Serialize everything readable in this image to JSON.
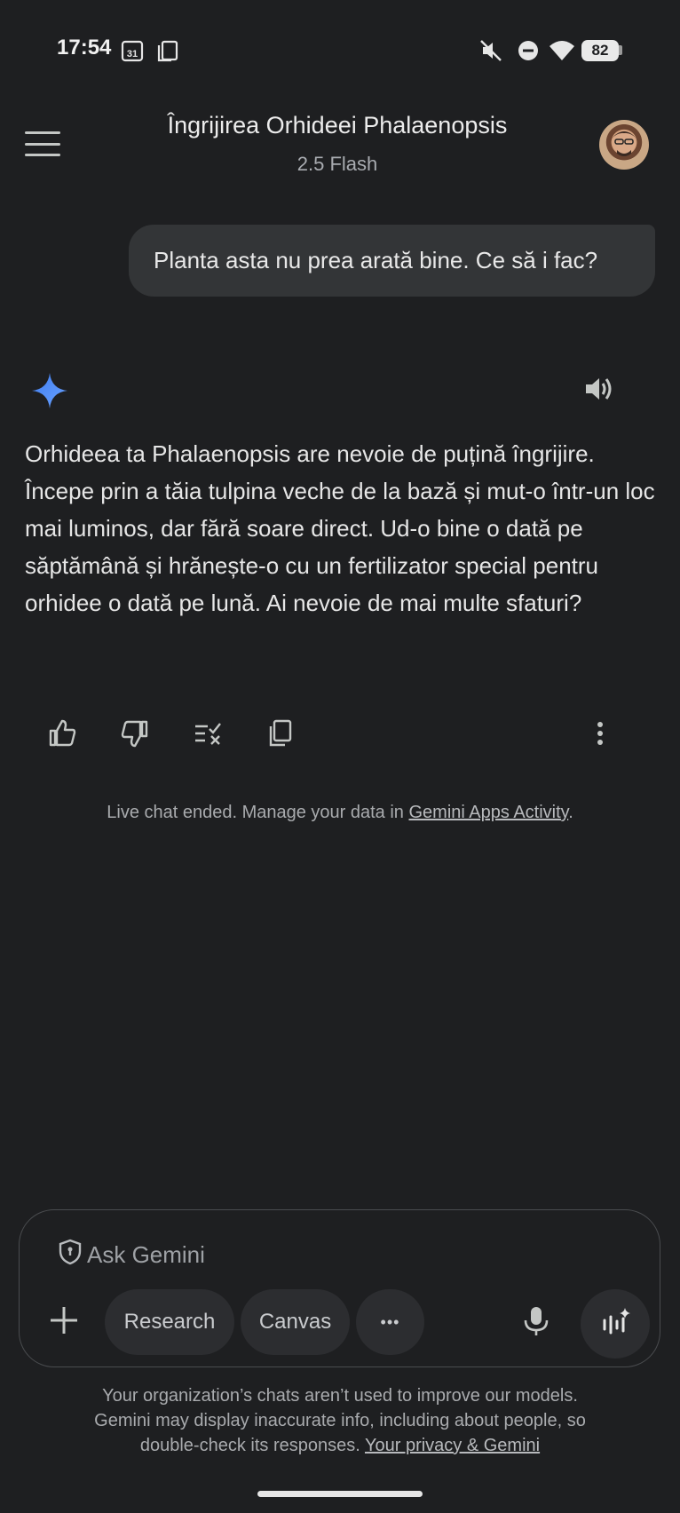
{
  "status_bar": {
    "time": "17:54",
    "calendar_day": "31",
    "battery": "82",
    "icons": [
      "calendar-icon",
      "screen-icon",
      "mute-icon",
      "dnd-icon",
      "wifi-icon",
      "battery-icon"
    ]
  },
  "header": {
    "title": "Îngrijirea Orhideei Phalaenopsis",
    "model": "2.5 Flash"
  },
  "conversation": {
    "user_message": "Planta asta nu prea arată bine. Ce să i fac?",
    "response": "Orhideea ta Phalaenopsis are nevoie de puțină îngrijire. Începe prin a tăia tulpina veche de la bază și mut-o într-un loc mai luminos, dar fără soare direct. Ud-o bine o dată pe săptămână și hrănește-o cu un fertilizator special pentru orhidee o dată pe lună. Ai nevoie de mai multe sfaturi?",
    "actions": [
      "thumbs-up-icon",
      "thumbs-down-icon",
      "double-check-icon",
      "copy-icon",
      "more-vert-icon"
    ]
  },
  "notice": {
    "text": "Live chat ended. Manage your data in ",
    "link": "Gemini Apps Activity",
    "suffix": "."
  },
  "input": {
    "placeholder": "Ask Gemini",
    "research_label": "Research",
    "canvas_label": "Canvas",
    "more_label": "•••"
  },
  "disclaimer": {
    "line1": "Your organization’s chats aren’t used to improve our models.",
    "line2": "Gemini may display inaccurate info, including about people, so",
    "line3": "double-check its responses. ",
    "link": "Your privacy & Gemini"
  },
  "colors": {
    "background": "#1e1f21",
    "bubble": "#333537",
    "gemini_blue": "#4a86f0"
  }
}
